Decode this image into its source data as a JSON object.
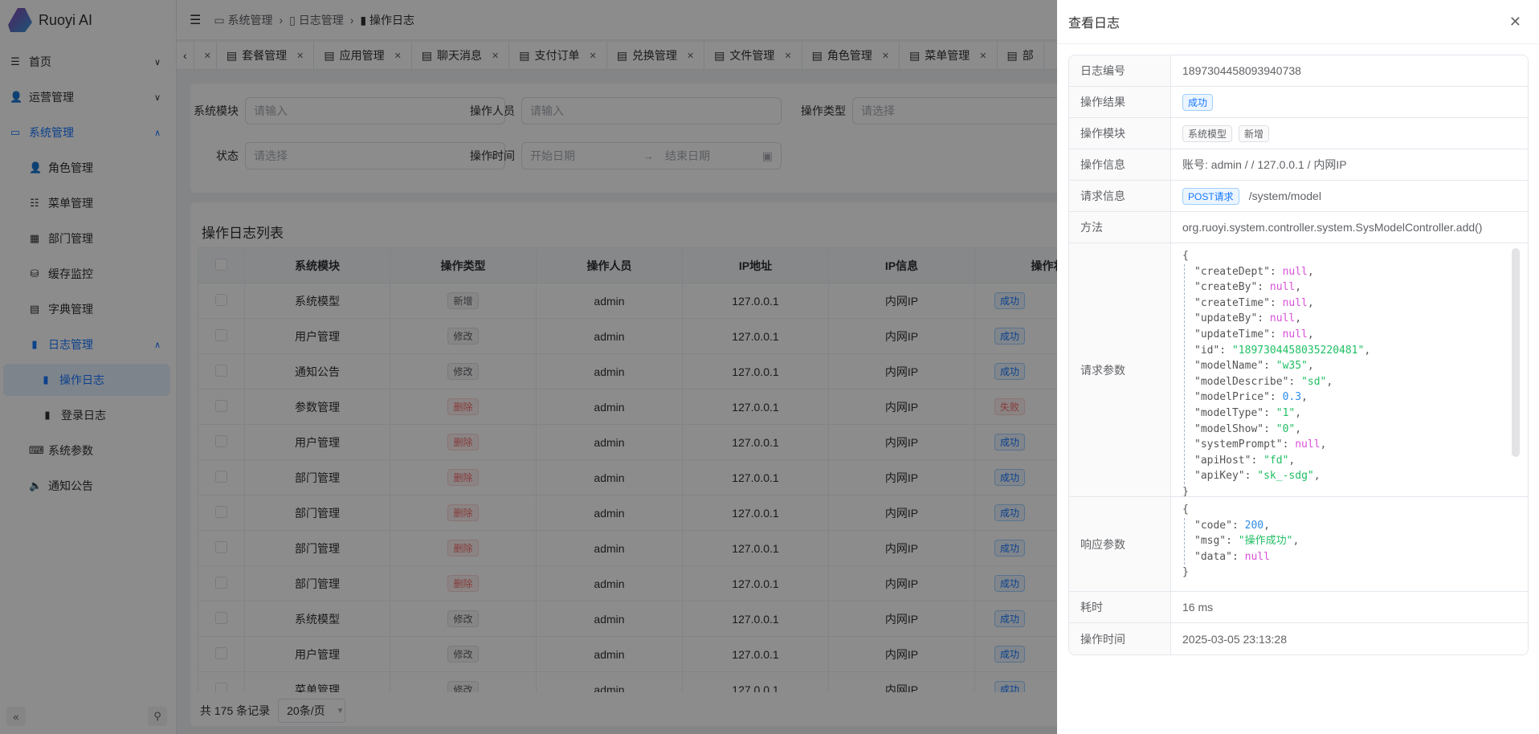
{
  "app": {
    "title": "Ruoyi AI"
  },
  "sidebar": {
    "items": [
      {
        "label": "首页",
        "icon": "list-icon"
      },
      {
        "label": "运营管理",
        "icon": "user-icon"
      },
      {
        "label": "系统管理",
        "icon": "monitor-icon"
      },
      {
        "label": "角色管理",
        "icon": "user-icon"
      },
      {
        "label": "菜单管理",
        "icon": "menu-icon"
      },
      {
        "label": "部门管理",
        "icon": "tree-icon"
      },
      {
        "label": "缓存监控",
        "icon": "database-icon"
      },
      {
        "label": "字典管理",
        "icon": "book-icon"
      },
      {
        "label": "日志管理",
        "icon": "document-icon"
      },
      {
        "label": "操作日志",
        "icon": "document-icon"
      },
      {
        "label": "登录日志",
        "icon": "document-icon"
      },
      {
        "label": "系统参数",
        "icon": "code-icon"
      },
      {
        "label": "通知公告",
        "icon": "speaker-icon"
      }
    ]
  },
  "breadcrumb": [
    "系统管理",
    "日志管理",
    "操作日志"
  ],
  "tabs": [
    "套餐管理",
    "应用管理",
    "聊天消息",
    "支付订单",
    "兑换管理",
    "文件管理",
    "角色管理",
    "菜单管理",
    "部"
  ],
  "search": {
    "module_label": "系统模块",
    "module_placeholder": "请输入",
    "operator_label": "操作人员",
    "operator_placeholder": "请输入",
    "type_label": "操作类型",
    "type_placeholder": "请选择",
    "status_label": "状态",
    "status_placeholder": "请选择",
    "time_label": "操作时间",
    "start_placeholder": "开始日期",
    "end_placeholder": "结束日期"
  },
  "table": {
    "title": "操作日志列表",
    "columns": [
      "系统模块",
      "操作类型",
      "操作人员",
      "IP地址",
      "IP信息",
      "操作状"
    ],
    "rows": [
      [
        "系统模型",
        "新增",
        "admin",
        "127.0.0.1",
        "内网IP",
        "成功"
      ],
      [
        "用户管理",
        "修改",
        "admin",
        "127.0.0.1",
        "内网IP",
        "成功"
      ],
      [
        "通知公告",
        "修改",
        "admin",
        "127.0.0.1",
        "内网IP",
        "成功"
      ],
      [
        "参数管理",
        "删除",
        "admin",
        "127.0.0.1",
        "内网IP",
        "失败"
      ],
      [
        "用户管理",
        "删除",
        "admin",
        "127.0.0.1",
        "内网IP",
        "成功"
      ],
      [
        "部门管理",
        "删除",
        "admin",
        "127.0.0.1",
        "内网IP",
        "成功"
      ],
      [
        "部门管理",
        "删除",
        "admin",
        "127.0.0.1",
        "内网IP",
        "成功"
      ],
      [
        "部门管理",
        "删除",
        "admin",
        "127.0.0.1",
        "内网IP",
        "成功"
      ],
      [
        "部门管理",
        "删除",
        "admin",
        "127.0.0.1",
        "内网IP",
        "成功"
      ],
      [
        "系统模型",
        "修改",
        "admin",
        "127.0.0.1",
        "内网IP",
        "成功"
      ],
      [
        "用户管理",
        "修改",
        "admin",
        "127.0.0.1",
        "内网IP",
        "成功"
      ],
      [
        "菜单管理",
        "修改",
        "admin",
        "127.0.0.1",
        "内网IP",
        "成功"
      ]
    ],
    "total_text": "共 175 条记录",
    "page_size": "20条/页"
  },
  "drawer": {
    "title": "查看日志",
    "labels": {
      "id": "日志编号",
      "result": "操作结果",
      "module": "操作模块",
      "info": "操作信息",
      "request": "请求信息",
      "method": "方法",
      "params": "请求参数",
      "response": "响应参数",
      "cost": "耗时",
      "time": "操作时间"
    },
    "id": "1897304458093940738",
    "result": "成功",
    "module_tags": [
      "系统模型",
      "新增"
    ],
    "info": "账号: admin / / 127.0.0.1 / 内网IP",
    "request_method": "POST请求",
    "request_url": "/system/model",
    "method": "org.ruoyi.system.controller.system.SysModelController.add()",
    "params": [
      [
        "createDept",
        "null",
        "null"
      ],
      [
        "createBy",
        "null",
        "null"
      ],
      [
        "createTime",
        "null",
        "null"
      ],
      [
        "updateBy",
        "null",
        "null"
      ],
      [
        "updateTime",
        "null",
        "null"
      ],
      [
        "id",
        "\"1897304458035220481\"",
        "string"
      ],
      [
        "modelName",
        "\"w35\"",
        "string"
      ],
      [
        "modelDescribe",
        "\"sd\"",
        "string"
      ],
      [
        "modelPrice",
        "0.3",
        "number"
      ],
      [
        "modelType",
        "\"1\"",
        "string"
      ],
      [
        "modelShow",
        "\"0\"",
        "string"
      ],
      [
        "systemPrompt",
        "null",
        "null"
      ],
      [
        "apiHost",
        "\"fd\"",
        "string"
      ],
      [
        "apiKey",
        "\"sk_-sdg\"",
        "string"
      ]
    ],
    "response": [
      [
        "code",
        "200",
        "number"
      ],
      [
        "msg",
        "\"操作成功\"",
        "string"
      ],
      [
        "data",
        "null",
        "null"
      ]
    ],
    "cost": "16 ms",
    "time": "2025-03-05 23:13:28"
  },
  "colors": {
    "primary": "#1677ff",
    "danger": "#f56c6c",
    "json_null": "#d94fd9",
    "json_string": "#1fbf63",
    "json_number": "#2a8ce8"
  }
}
